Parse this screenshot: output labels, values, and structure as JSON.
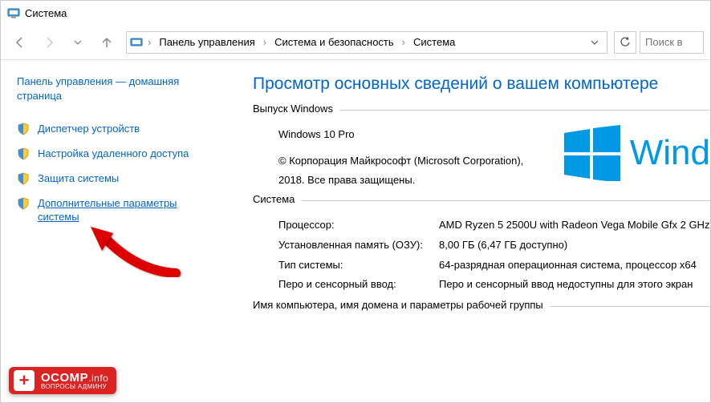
{
  "titlebar": {
    "title": "Система"
  },
  "nav": {
    "crumbs": [
      "Панель управления",
      "Система и безопасность",
      "Система"
    ],
    "search_placeholder": "Поиск в"
  },
  "sidebar": {
    "home": "Панель управления — домашняя страница",
    "links": [
      {
        "label": "Диспетчер устройств"
      },
      {
        "label": "Настройка удаленного доступа"
      },
      {
        "label": "Защита системы"
      },
      {
        "label": "Дополнительные параметры системы"
      }
    ]
  },
  "main": {
    "heading": "Просмотр основных сведений о вашем компьютере",
    "edition_legend": "Выпуск Windows",
    "edition_name": "Windows 10 Pro",
    "copyright": "© Корпорация Майкрософт (Microsoft Corporation), 2018. Все права защищены.",
    "brand": "Wind",
    "system_legend": "Система",
    "rows": [
      {
        "k": "Процессор:",
        "v": "AMD Ryzen 5 2500U with Radeon Vega Mobile Gfx    2 GHz"
      },
      {
        "k": "Установленная память (ОЗУ):",
        "v": "8,00 ГБ (6,47 ГБ доступно)"
      },
      {
        "k": "Тип системы:",
        "v": "64-разрядная операционная система, процессор x64"
      },
      {
        "k": "Перо и сенсорный ввод:",
        "v": "Перо и сенсорный ввод недоступны для этого экран"
      }
    ],
    "footer_legend": "Имя компьютера, имя домена и параметры рабочей группы"
  },
  "badge": {
    "brand": "OCOMP",
    "domain": ".info",
    "sub": "ВОПРОСЫ АДМИНУ"
  }
}
